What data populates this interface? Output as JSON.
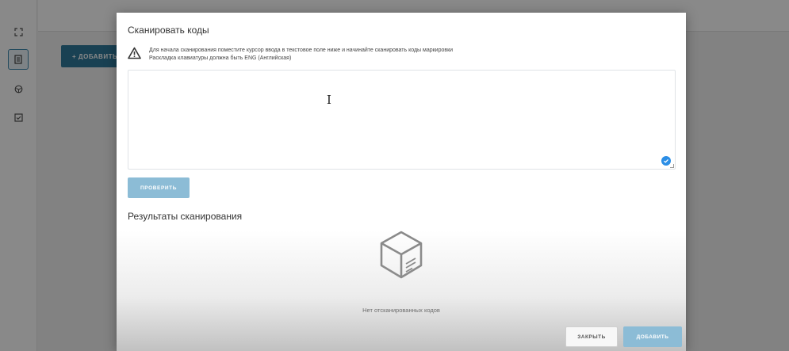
{
  "background": {
    "add_button_label": "+ ДОБАВИТЬ Т"
  },
  "sidebar": {
    "items": [
      {
        "icon": "expand-icon"
      },
      {
        "icon": "document-icon",
        "active": true
      },
      {
        "icon": "box-icon"
      },
      {
        "icon": "checklist-icon"
      }
    ]
  },
  "modal": {
    "title": "Сканировать коды",
    "warning": {
      "icon": "warning-icon",
      "line1": "Для начала сканирования поместите курсор ввода в текстовое поле ниже и начинайте сканировать коды маркировки",
      "line2": "Раскладка клавиатуры должна быть ENG (Английская)"
    },
    "textarea": {
      "value": "",
      "cursor": "I"
    },
    "check_button": "ПРОВЕРИТЬ",
    "results_title": "Результаты сканирования",
    "empty_state": {
      "icon": "empty-box-icon",
      "text": "Нет отсканированных кодов"
    },
    "close_button": "ЗАКРЫТЬ",
    "add_button": "ДОБАВИТЬ"
  },
  "colors": {
    "primary": "#1f6f93",
    "primary_disabled": "#8cbcd6",
    "badge": "#2b8ee6"
  }
}
